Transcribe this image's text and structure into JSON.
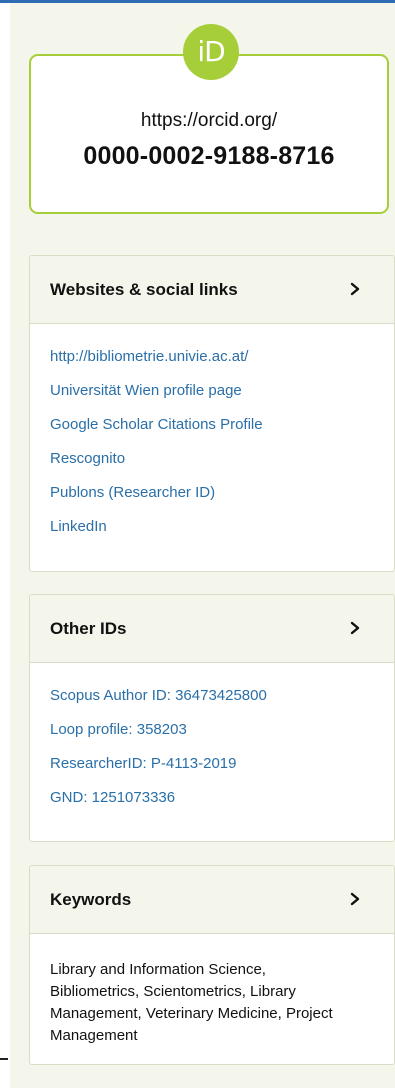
{
  "orcid": {
    "logo_text": "iD",
    "url_prefix": "https://orcid.org/",
    "id_number": "0000-0002-9188-8716",
    "brand_color": "#a6ce39"
  },
  "websites": {
    "title": "Websites & social links",
    "chevron_icon": "chevron-right-icon",
    "links": [
      "http://bibliometrie.univie.ac.at/",
      "Universität Wien profile page",
      "Google Scholar Citations Profile",
      "Rescognito",
      "Publons (Researcher ID)",
      "LinkedIn"
    ]
  },
  "other_ids": {
    "title": "Other IDs",
    "chevron_icon": "chevron-right-icon",
    "links": [
      "Scopus Author ID: 36473425800",
      "Loop profile: 358203",
      "ResearcherID: P-4113-2019",
      "GND: 1251073336"
    ]
  },
  "keywords": {
    "title": "Keywords",
    "chevron_icon": "chevron-right-icon",
    "text": "Library and Information Science, Bibliometrics, Scientometrics, Library Management, Veterinary Medicine, Project Management"
  },
  "colors": {
    "link": "#2a6fa8",
    "panel_header_bg": "#f4f6ec",
    "top_bar": "#2e6db4"
  }
}
